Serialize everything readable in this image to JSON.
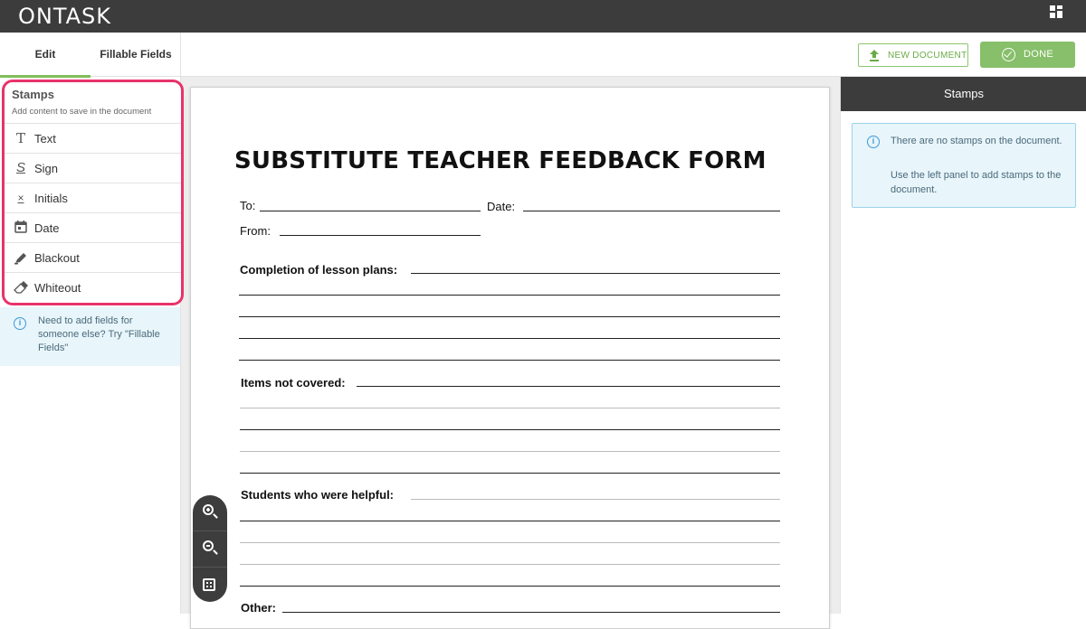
{
  "app": {
    "logo_text": "ONTASK"
  },
  "left_panel": {
    "tabs": [
      {
        "label": "Edit",
        "active": true
      },
      {
        "label": "Fillable Fields",
        "active": false
      }
    ],
    "stamps": {
      "title": "Stamps",
      "subtitle": "Add content to save in the document",
      "items": [
        {
          "label": "Text",
          "icon": "text-T-icon"
        },
        {
          "label": "Sign",
          "icon": "signature-icon"
        },
        {
          "label": "Initials",
          "icon": "initials-x-icon"
        },
        {
          "label": "Date",
          "icon": "calendar-icon"
        },
        {
          "label": "Blackout",
          "icon": "marker-icon"
        },
        {
          "label": "Whiteout",
          "icon": "eraser-icon"
        }
      ]
    },
    "info": "Need to add fields for someone else? Try \"Fillable Fields\""
  },
  "toolbar": {
    "new_document_label": "NEW DOCUMENT",
    "done_label": "DONE",
    "accent_color": "#87bf6a"
  },
  "document": {
    "title": "SUBSTITUTE TEACHER FEEDBACK FORM",
    "to_label": "To:",
    "date_label": "Date:",
    "from_label": "From:",
    "section1": "Completion of lesson plans:",
    "section2": "Items not covered:",
    "section3": "Students who were helpful:",
    "section4": "Other:"
  },
  "right_panel": {
    "header": "Stamps",
    "info_line1": "There are no stamps on the document.",
    "info_line2": "Use the left panel to add stamps to the document."
  },
  "highlight_color": "#e8336a"
}
